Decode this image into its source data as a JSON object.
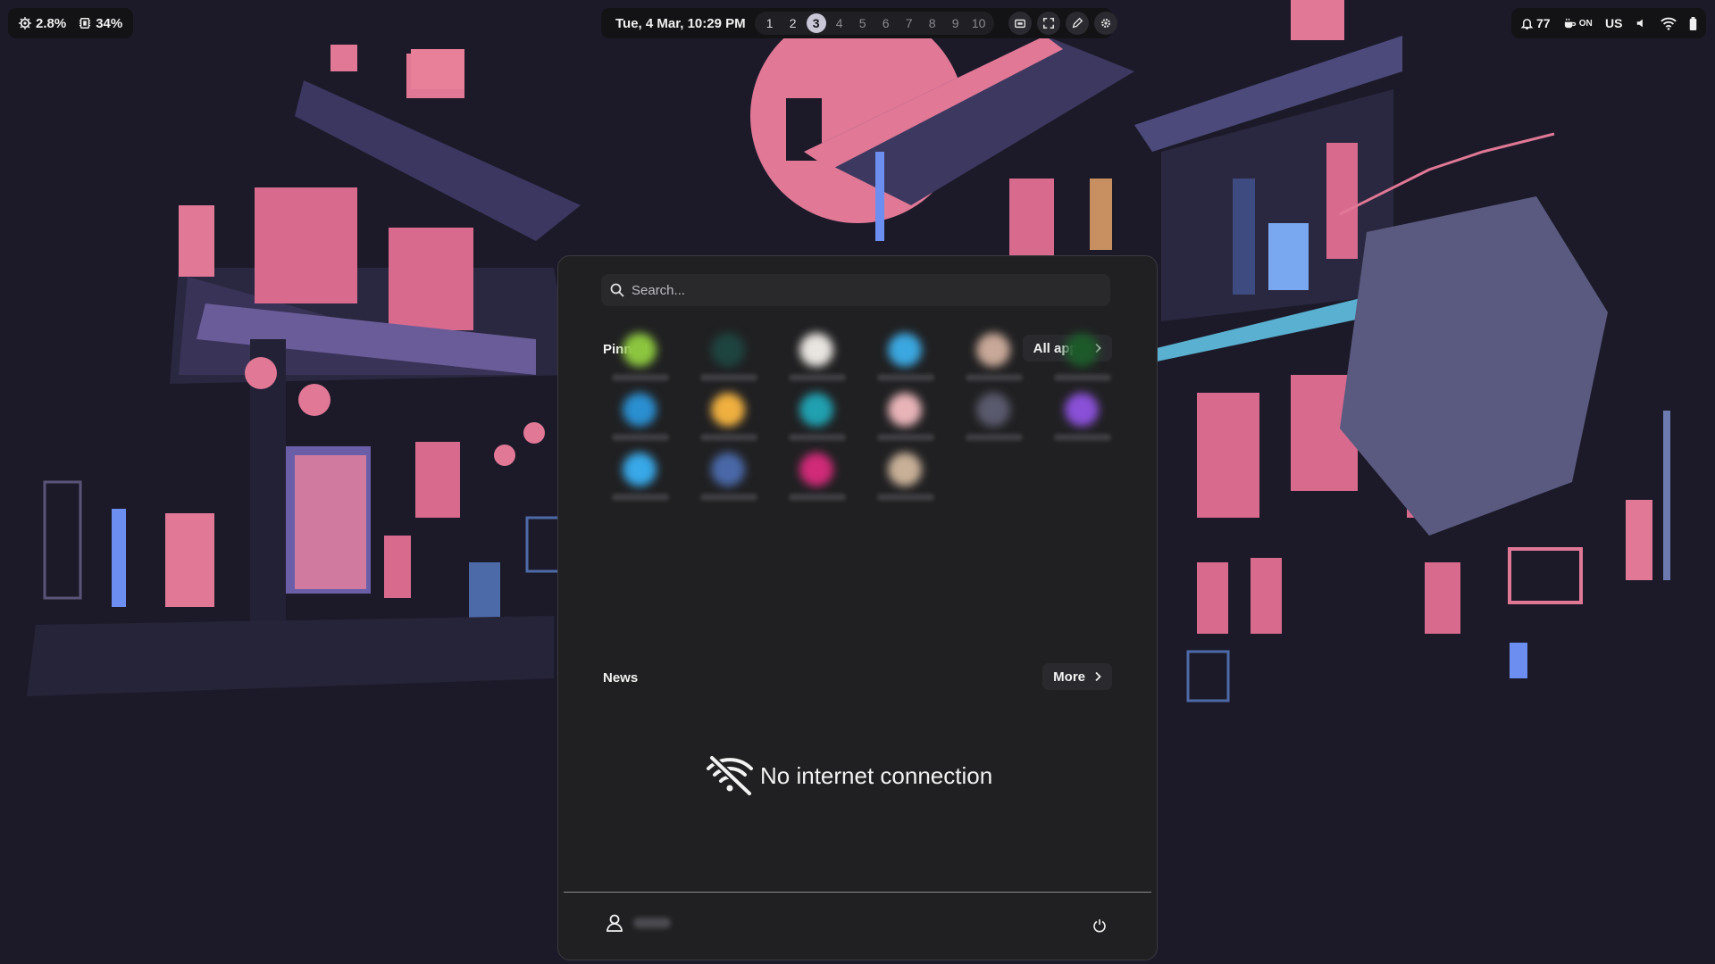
{
  "topbar": {
    "cpu": "2.8%",
    "memory": "34%",
    "clock": "Tue, 4 Mar, 10:29 PM",
    "workspaces": [
      {
        "label": "1",
        "state": "occupied"
      },
      {
        "label": "2",
        "state": "occupied"
      },
      {
        "label": "3",
        "state": "active"
      },
      {
        "label": "4",
        "state": "empty"
      },
      {
        "label": "5",
        "state": "empty"
      },
      {
        "label": "6",
        "state": "empty"
      },
      {
        "label": "7",
        "state": "empty"
      },
      {
        "label": "8",
        "state": "empty"
      },
      {
        "label": "9",
        "state": "empty"
      },
      {
        "label": "10",
        "state": "empty"
      }
    ],
    "notifications": "77",
    "caffeine": "ON",
    "keyboard_layout": "US"
  },
  "launcher": {
    "search_placeholder": "Search...",
    "pinned_title": "Pinned",
    "all_apps_label": "All apps",
    "news_title": "News",
    "more_label": "More",
    "no_internet": "No internet connection",
    "pinned_icon_colors": [
      "#8cc63f",
      "#1e4440",
      "#e8e4e0",
      "#3ba7e0",
      "#c8a898",
      "#1d5a2a",
      "#2a8fd0",
      "#f0b040",
      "#20a0b0",
      "#e8b4b8",
      "#5a5a6e",
      "#8a50d8",
      "#38a8e8",
      "#4a68a8",
      "#d02a78",
      "#c8b098"
    ]
  },
  "colors": {
    "accent": "#c9c6d6",
    "panel": "#202022",
    "bar": "#131316"
  }
}
